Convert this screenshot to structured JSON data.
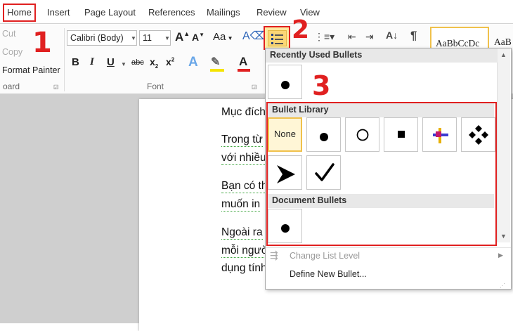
{
  "tabs": [
    "Home",
    "Insert",
    "Page Layout",
    "References",
    "Mailings",
    "Review",
    "View"
  ],
  "clipboard": {
    "cut": "Cut",
    "copy": "Copy",
    "format_painter": "Format Painter",
    "group": "oard"
  },
  "font": {
    "name": "Calibri (Body)",
    "size": "11",
    "group": "Font",
    "case": "Aa"
  },
  "styles": {
    "sample": "AaBbCcDc",
    "sample2": "AaB"
  },
  "annotations": {
    "n1": "1",
    "n2": "2",
    "n3": "3"
  },
  "document": {
    "lines": [
      "Mục đích",
      "Trong từ",
      "với nhiều",
      "Bạn có th",
      "muốn in",
      "Ngoài ra",
      "mỗi ngườ",
      "dụng tính"
    ]
  },
  "bullets_menu": {
    "recently_used": "Recently Used Bullets",
    "library": "Bullet Library",
    "document_bullets": "Document Bullets",
    "none_label": "None",
    "change_level": "Change List Level",
    "define_new": "Define New Bullet..."
  },
  "colors": {
    "highlight": "#e02020",
    "selected_border": "#f0c14b",
    "accent_blue": "#1d3b82"
  }
}
